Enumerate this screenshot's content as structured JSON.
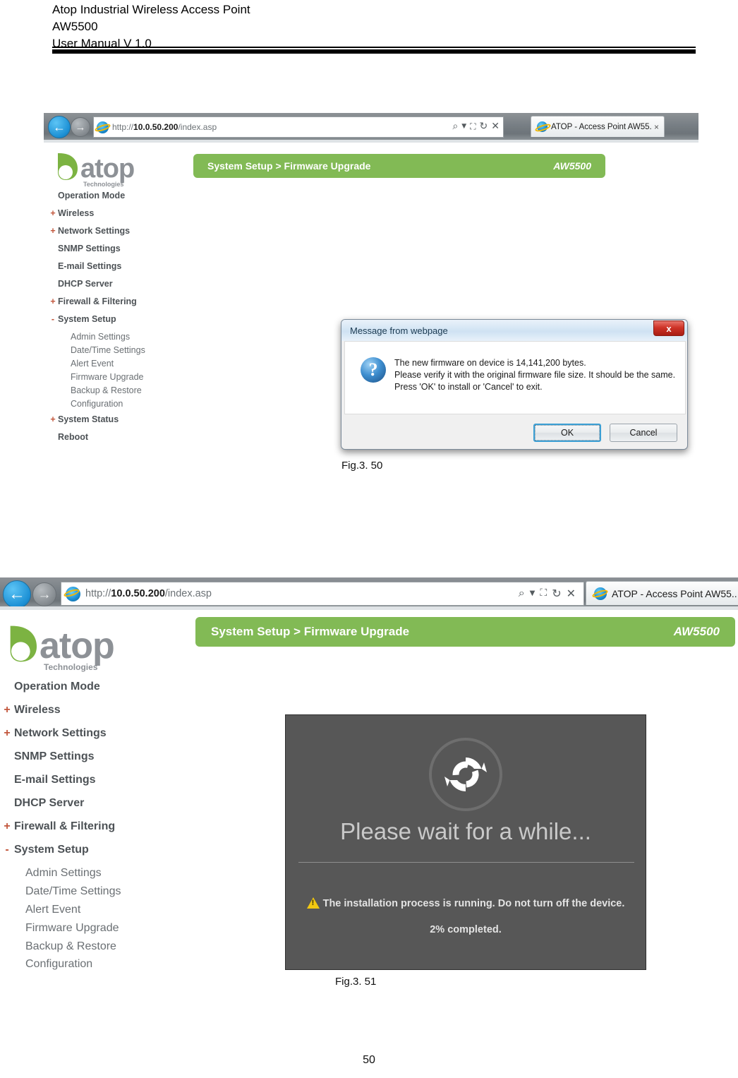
{
  "document": {
    "header_lines": [
      "Atop Industrial Wireless Access Point",
      "AW5500",
      "User Manual V 1.0"
    ],
    "page_number": "50"
  },
  "figures": [
    {
      "caption": "Fig.3. 50",
      "browser": {
        "back_icon": "back-arrow-icon",
        "forward_icon": "forward-arrow-icon",
        "favicon": "internet-explorer-icon",
        "url_prefix": "http://",
        "url_host": "10.0.50.200",
        "url_path": "/index.asp",
        "address_icons": [
          "search-icon",
          "chevron-down-icon",
          "compatibility-view-icon",
          "refresh-icon",
          "stop-icon"
        ],
        "tab_title": "ATOP - Access Point AW55...",
        "tab_close": "×"
      },
      "webapp": {
        "logo_word": "atop",
        "logo_sub": "Technologies",
        "breadcrumb": "System Setup > Firmware Upgrade",
        "model": "AW5500",
        "accent_color": "#82ba55",
        "menu": [
          {
            "prefix": "",
            "label": "Operation Mode",
            "level": "top"
          },
          {
            "prefix": "+",
            "label": "Wireless",
            "level": "top"
          },
          {
            "prefix": "+",
            "label": "Network Settings",
            "level": "top"
          },
          {
            "prefix": "",
            "label": "SNMP Settings",
            "level": "top"
          },
          {
            "prefix": "",
            "label": "E-mail Settings",
            "level": "top"
          },
          {
            "prefix": "",
            "label": "DHCP Server",
            "level": "top"
          },
          {
            "prefix": "+",
            "label": "Firewall & Filtering",
            "level": "top"
          },
          {
            "prefix": "-",
            "label": "System Setup",
            "level": "top"
          },
          {
            "prefix": "",
            "label": "Admin Settings",
            "level": "sub"
          },
          {
            "prefix": "",
            "label": "Date/Time Settings",
            "level": "sub"
          },
          {
            "prefix": "",
            "label": "Alert Event",
            "level": "sub"
          },
          {
            "prefix": "",
            "label": "Firmware Upgrade",
            "level": "sub"
          },
          {
            "prefix": "",
            "label": "Backup & Restore",
            "level": "sub"
          },
          {
            "prefix": "",
            "label": "Configuration",
            "level": "sub"
          },
          {
            "prefix": "+",
            "label": "System Status",
            "level": "top"
          },
          {
            "prefix": "",
            "label": "Reboot",
            "level": "top"
          }
        ]
      },
      "dialog": {
        "title": "Message from webpage",
        "close_label": "x",
        "icon": "question-mark-icon",
        "message_lines": [
          "The new firmware on device is 14,141,200 bytes.",
          "Please verify it with the original firmware file size. It should be the same.",
          "Press 'OK' to install or 'Cancel' to exit."
        ],
        "ok_label": "OK",
        "cancel_label": "Cancel"
      }
    },
    {
      "caption": "Fig.3. 51",
      "browser": {
        "back_icon": "back-arrow-icon",
        "forward_icon": "forward-arrow-icon",
        "favicon": "internet-explorer-icon",
        "url_prefix": "http://",
        "url_host": "10.0.50.200",
        "url_path": "/index.asp",
        "address_icons": [
          "search-icon",
          "chevron-down-icon",
          "compatibility-view-icon",
          "refresh-icon",
          "stop-icon"
        ],
        "tab_title": "ATOP - Access Point AW55..",
        "tab_close": ""
      },
      "webapp": {
        "logo_word": "atop",
        "logo_sub": "Technologies",
        "breadcrumb": "System Setup > Firmware Upgrade",
        "model": "AW5500",
        "accent_color": "#82ba55",
        "menu": [
          {
            "prefix": "",
            "label": "Operation Mode",
            "level": "top"
          },
          {
            "prefix": "+",
            "label": "Wireless",
            "level": "top"
          },
          {
            "prefix": "+",
            "label": "Network Settings",
            "level": "top"
          },
          {
            "prefix": "",
            "label": "SNMP Settings",
            "level": "top"
          },
          {
            "prefix": "",
            "label": "E-mail Settings",
            "level": "top"
          },
          {
            "prefix": "",
            "label": "DHCP Server",
            "level": "top"
          },
          {
            "prefix": "+",
            "label": "Firewall & Filtering",
            "level": "top"
          },
          {
            "prefix": "-",
            "label": "System Setup",
            "level": "top"
          },
          {
            "prefix": "",
            "label": "Admin Settings",
            "level": "sub"
          },
          {
            "prefix": "",
            "label": "Date/Time Settings",
            "level": "sub"
          },
          {
            "prefix": "",
            "label": "Alert Event",
            "level": "sub"
          },
          {
            "prefix": "",
            "label": "Firmware Upgrade",
            "level": "sub"
          },
          {
            "prefix": "",
            "label": "Backup & Restore",
            "level": "sub"
          },
          {
            "prefix": "",
            "label": "Configuration",
            "level": "sub"
          }
        ]
      },
      "progress": {
        "spinner_icon": "refresh-spinner-icon",
        "heading": "Please wait for a while...",
        "warning_icon": "warning-triangle-icon",
        "warning_text": "The installation process is running. Do not turn off the device.",
        "percent_text": "2% completed.",
        "percent_value": 2,
        "panel_color": "#575757"
      }
    }
  ]
}
